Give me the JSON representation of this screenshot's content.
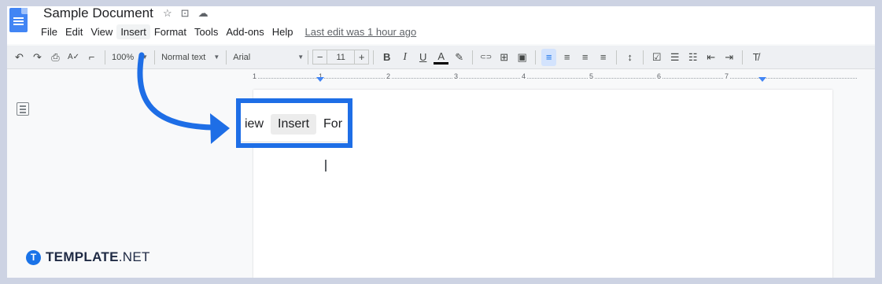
{
  "document": {
    "title": "Sample Document",
    "last_edit": "Last edit was 1 hour ago"
  },
  "title_icons": [
    {
      "name": "star-icon",
      "glyph": "☆"
    },
    {
      "name": "move-to-folder-icon",
      "glyph": "⊡"
    },
    {
      "name": "cloud-status-icon",
      "glyph": "☁"
    }
  ],
  "menu": [
    "File",
    "Edit",
    "View",
    "Insert",
    "Format",
    "Tools",
    "Add-ons",
    "Help"
  ],
  "active_menu": "Insert",
  "toolbar": {
    "zoom": "100%",
    "style": "Normal text",
    "font": "Arial",
    "font_size": "11",
    "minus": "−",
    "plus": "+",
    "bold": "B",
    "italic": "I",
    "underline": "U",
    "text_color": "A",
    "undo_icon": "↶",
    "redo_icon": "↷",
    "print_icon": "⎙",
    "spellcheck_icon": "A✓",
    "paint_format_icon": "⌐",
    "highlight_icon": "✎",
    "link_icon": "⊂⊃",
    "comment_icon": "⊞",
    "image_icon": "▣",
    "align_left_icon": "≡",
    "align_center_icon": "≡",
    "align_right_icon": "≡",
    "justify_icon": "≡",
    "line_spacing_icon": "↕",
    "checklist_icon": "☑",
    "bullet_list_icon": "☰",
    "numbered_list_icon": "☷",
    "decrease_indent_icon": "⇤",
    "increase_indent_icon": "⇥",
    "clear_format_icon": "T̸"
  },
  "ruler": [
    "1",
    "1",
    "2",
    "3",
    "4",
    "5",
    "6",
    "7"
  ],
  "callout": {
    "items": [
      "iew",
      "Insert",
      "For"
    ],
    "active": "Insert"
  },
  "brand": {
    "name": "TEMPLATE",
    "suffix": ".NET",
    "logo_letter": "T"
  },
  "colors": {
    "accent": "#1e6ee6",
    "docs_blue": "#4285f4",
    "brand_blue": "#1a73e8"
  }
}
